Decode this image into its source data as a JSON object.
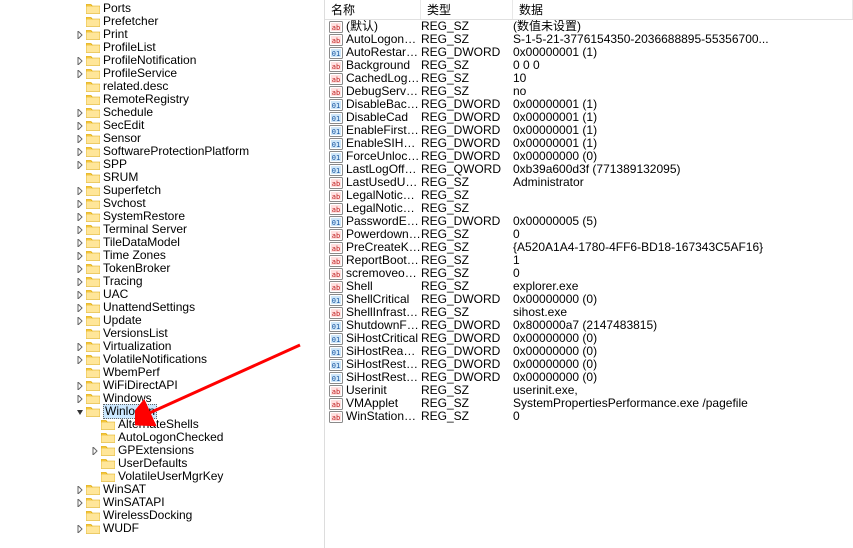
{
  "columns": {
    "name": "名称",
    "type": "类型",
    "data": "数据"
  },
  "tree": [
    {
      "indent": 5,
      "expander": "",
      "label": "Ports"
    },
    {
      "indent": 5,
      "expander": "",
      "label": "Prefetcher"
    },
    {
      "indent": 5,
      "expander": ">",
      "label": "Print"
    },
    {
      "indent": 5,
      "expander": "",
      "label": "ProfileList"
    },
    {
      "indent": 5,
      "expander": ">",
      "label": "ProfileNotification"
    },
    {
      "indent": 5,
      "expander": ">",
      "label": "ProfileService"
    },
    {
      "indent": 5,
      "expander": "",
      "label": "related.desc"
    },
    {
      "indent": 5,
      "expander": "",
      "label": "RemoteRegistry"
    },
    {
      "indent": 5,
      "expander": ">",
      "label": "Schedule"
    },
    {
      "indent": 5,
      "expander": ">",
      "label": "SecEdit"
    },
    {
      "indent": 5,
      "expander": ">",
      "label": "Sensor"
    },
    {
      "indent": 5,
      "expander": ">",
      "label": "SoftwareProtectionPlatform"
    },
    {
      "indent": 5,
      "expander": ">",
      "label": "SPP"
    },
    {
      "indent": 5,
      "expander": "",
      "label": "SRUM"
    },
    {
      "indent": 5,
      "expander": ">",
      "label": "Superfetch"
    },
    {
      "indent": 5,
      "expander": ">",
      "label": "Svchost"
    },
    {
      "indent": 5,
      "expander": ">",
      "label": "SystemRestore"
    },
    {
      "indent": 5,
      "expander": ">",
      "label": "Terminal Server"
    },
    {
      "indent": 5,
      "expander": ">",
      "label": "TileDataModel"
    },
    {
      "indent": 5,
      "expander": ">",
      "label": "Time Zones"
    },
    {
      "indent": 5,
      "expander": ">",
      "label": "TokenBroker"
    },
    {
      "indent": 5,
      "expander": ">",
      "label": "Tracing"
    },
    {
      "indent": 5,
      "expander": ">",
      "label": "UAC"
    },
    {
      "indent": 5,
      "expander": ">",
      "label": "UnattendSettings"
    },
    {
      "indent": 5,
      "expander": ">",
      "label": "Update"
    },
    {
      "indent": 5,
      "expander": "",
      "label": "VersionsList"
    },
    {
      "indent": 5,
      "expander": ">",
      "label": "Virtualization"
    },
    {
      "indent": 5,
      "expander": ">",
      "label": "VolatileNotifications"
    },
    {
      "indent": 5,
      "expander": "",
      "label": "WbemPerf"
    },
    {
      "indent": 5,
      "expander": ">",
      "label": "WiFiDirectAPI"
    },
    {
      "indent": 5,
      "expander": ">",
      "label": "Windows"
    },
    {
      "indent": 5,
      "expander": "v",
      "label": "Winlogon",
      "selected": true
    },
    {
      "indent": 6,
      "expander": "",
      "label": "AlternateShells"
    },
    {
      "indent": 6,
      "expander": "",
      "label": "AutoLogonChecked"
    },
    {
      "indent": 6,
      "expander": ">",
      "label": "GPExtensions"
    },
    {
      "indent": 6,
      "expander": "",
      "label": "UserDefaults"
    },
    {
      "indent": 6,
      "expander": "",
      "label": "VolatileUserMgrKey"
    },
    {
      "indent": 5,
      "expander": ">",
      "label": "WinSAT"
    },
    {
      "indent": 5,
      "expander": ">",
      "label": "WinSATAPI"
    },
    {
      "indent": 5,
      "expander": "",
      "label": "WirelessDocking"
    },
    {
      "indent": 5,
      "expander": ">",
      "label": "WUDF"
    }
  ],
  "values": [
    {
      "icon": "sz",
      "name": "(默认)",
      "type": "REG_SZ",
      "data": "(数值未设置)"
    },
    {
      "icon": "sz",
      "name": "AutoLogonSID",
      "type": "REG_SZ",
      "data": "S-1-5-21-3776154350-2036688895-55356700..."
    },
    {
      "icon": "dw",
      "name": "AutoRestartShell",
      "type": "REG_DWORD",
      "data": "0x00000001 (1)"
    },
    {
      "icon": "sz",
      "name": "Background",
      "type": "REG_SZ",
      "data": "0 0 0"
    },
    {
      "icon": "sz",
      "name": "CachedLogons...",
      "type": "REG_SZ",
      "data": "10"
    },
    {
      "icon": "sz",
      "name": "DebugServerCo...",
      "type": "REG_SZ",
      "data": "no"
    },
    {
      "icon": "dw",
      "name": "DisableBackBut...",
      "type": "REG_DWORD",
      "data": "0x00000001 (1)"
    },
    {
      "icon": "dw",
      "name": "DisableCad",
      "type": "REG_DWORD",
      "data": "0x00000001 (1)"
    },
    {
      "icon": "dw",
      "name": "EnableFirstLogo...",
      "type": "REG_DWORD",
      "data": "0x00000001 (1)"
    },
    {
      "icon": "dw",
      "name": "EnableSIHostIn...",
      "type": "REG_DWORD",
      "data": "0x00000001 (1)"
    },
    {
      "icon": "dw",
      "name": "ForceUnlockLo...",
      "type": "REG_DWORD",
      "data": "0x00000000 (0)"
    },
    {
      "icon": "dw",
      "name": "LastLogOffEndT...",
      "type": "REG_QWORD",
      "data": "0xb39a600d3f (771389132095)"
    },
    {
      "icon": "sz",
      "name": "LastUsedUsern...",
      "type": "REG_SZ",
      "data": "Administrator"
    },
    {
      "icon": "sz",
      "name": "LegalNoticeCap...",
      "type": "REG_SZ",
      "data": ""
    },
    {
      "icon": "sz",
      "name": "LegalNoticeText",
      "type": "REG_SZ",
      "data": ""
    },
    {
      "icon": "dw",
      "name": "PasswordExpiry...",
      "type": "REG_DWORD",
      "data": "0x00000005 (5)"
    },
    {
      "icon": "sz",
      "name": "PowerdownAfte...",
      "type": "REG_SZ",
      "data": "0"
    },
    {
      "icon": "sz",
      "name": "PreCreateKnow...",
      "type": "REG_SZ",
      "data": "{A520A1A4-1780-4FF6-BD18-167343C5AF16}"
    },
    {
      "icon": "sz",
      "name": "ReportBootOk",
      "type": "REG_SZ",
      "data": "1"
    },
    {
      "icon": "sz",
      "name": "scremoveoption",
      "type": "REG_SZ",
      "data": "0"
    },
    {
      "icon": "sz",
      "name": "Shell",
      "type": "REG_SZ",
      "data": "explorer.exe"
    },
    {
      "icon": "dw",
      "name": "ShellCritical",
      "type": "REG_DWORD",
      "data": "0x00000000 (0)"
    },
    {
      "icon": "sz",
      "name": "ShellInfrastruct...",
      "type": "REG_SZ",
      "data": "sihost.exe"
    },
    {
      "icon": "dw",
      "name": "ShutdownFlags",
      "type": "REG_DWORD",
      "data": "0x800000a7 (2147483815)"
    },
    {
      "icon": "dw",
      "name": "SiHostCritical",
      "type": "REG_DWORD",
      "data": "0x00000000 (0)"
    },
    {
      "icon": "dw",
      "name": "SiHostReadyTi...",
      "type": "REG_DWORD",
      "data": "0x00000000 (0)"
    },
    {
      "icon": "dw",
      "name": "SiHostRestartC...",
      "type": "REG_DWORD",
      "data": "0x00000000 (0)"
    },
    {
      "icon": "dw",
      "name": "SiHostRestartTi...",
      "type": "REG_DWORD",
      "data": "0x00000000 (0)"
    },
    {
      "icon": "sz",
      "name": "Userinit",
      "type": "REG_SZ",
      "data": "userinit.exe,"
    },
    {
      "icon": "sz",
      "name": "VMApplet",
      "type": "REG_SZ",
      "data": "SystemPropertiesPerformance.exe /pagefile"
    },
    {
      "icon": "sz",
      "name": "WinStationsDis...",
      "type": "REG_SZ",
      "data": "0"
    }
  ]
}
